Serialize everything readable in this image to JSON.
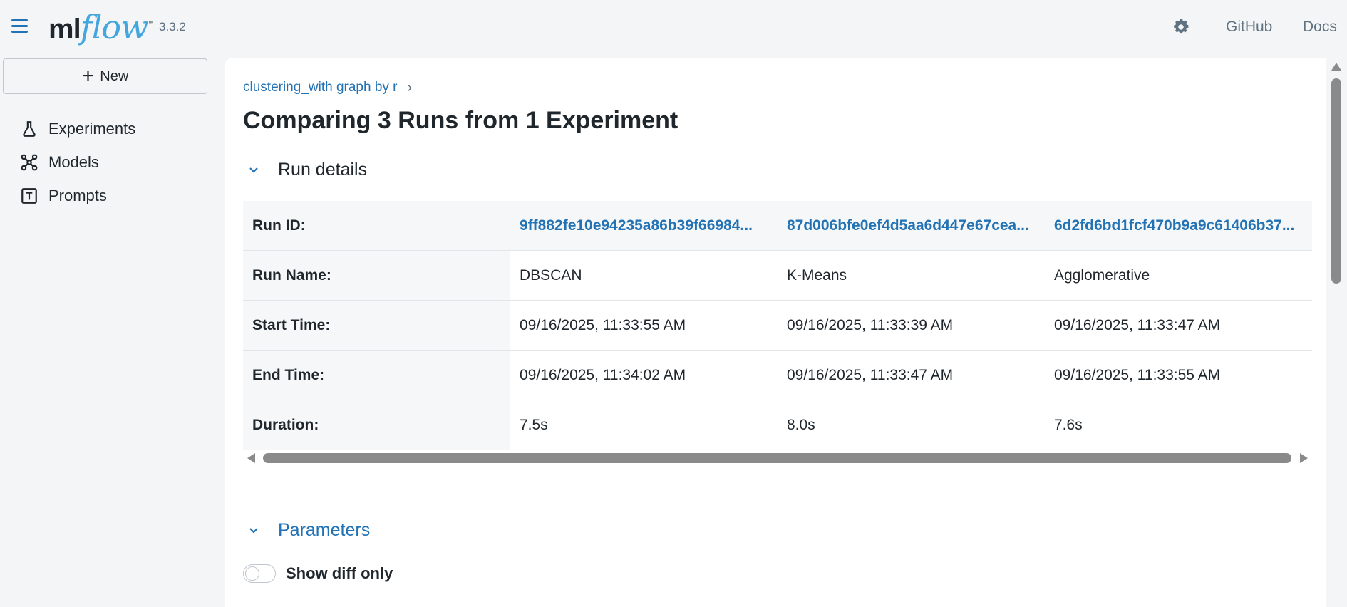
{
  "header": {
    "logo_ml": "ml",
    "logo_flow": "flow",
    "logo_tm": "™",
    "version": "3.3.2",
    "github_label": "GitHub",
    "docs_label": "Docs"
  },
  "sidebar": {
    "new_label": "New",
    "items": [
      {
        "label": "Experiments",
        "icon": "beaker-icon"
      },
      {
        "label": "Models",
        "icon": "models-icon"
      },
      {
        "label": "Prompts",
        "icon": "prompts-icon"
      }
    ]
  },
  "main": {
    "breadcrumb": "clustering_with graph by r",
    "title": "Comparing 3 Runs from 1 Experiment",
    "run_details_label": "Run details",
    "parameters_label": "Parameters",
    "show_diff_label": "Show diff only"
  },
  "table": {
    "rows": [
      {
        "label": "Run ID:",
        "values": [
          "9ff882fe10e94235a86b39f66984...",
          "87d006bfe0ef4d5aa6d447e67cea...",
          "6d2fd6bd1fcf470b9a9c61406b37..."
        ]
      },
      {
        "label": "Run Name:",
        "values": [
          "DBSCAN",
          "K-Means",
          "Agglomerative"
        ]
      },
      {
        "label": "Start Time:",
        "values": [
          "09/16/2025, 11:33:55 AM",
          "09/16/2025, 11:33:39 AM",
          "09/16/2025, 11:33:47 AM"
        ]
      },
      {
        "label": "End Time:",
        "values": [
          "09/16/2025, 11:34:02 AM",
          "09/16/2025, 11:33:47 AM",
          "09/16/2025, 11:33:55 AM"
        ]
      },
      {
        "label": "Duration:",
        "values": [
          "7.5s",
          "8.0s",
          "7.6s"
        ]
      }
    ]
  },
  "colors": {
    "accent": "#2272b4",
    "logo_flow": "#43a6dd",
    "background": "#f4f5f7"
  }
}
